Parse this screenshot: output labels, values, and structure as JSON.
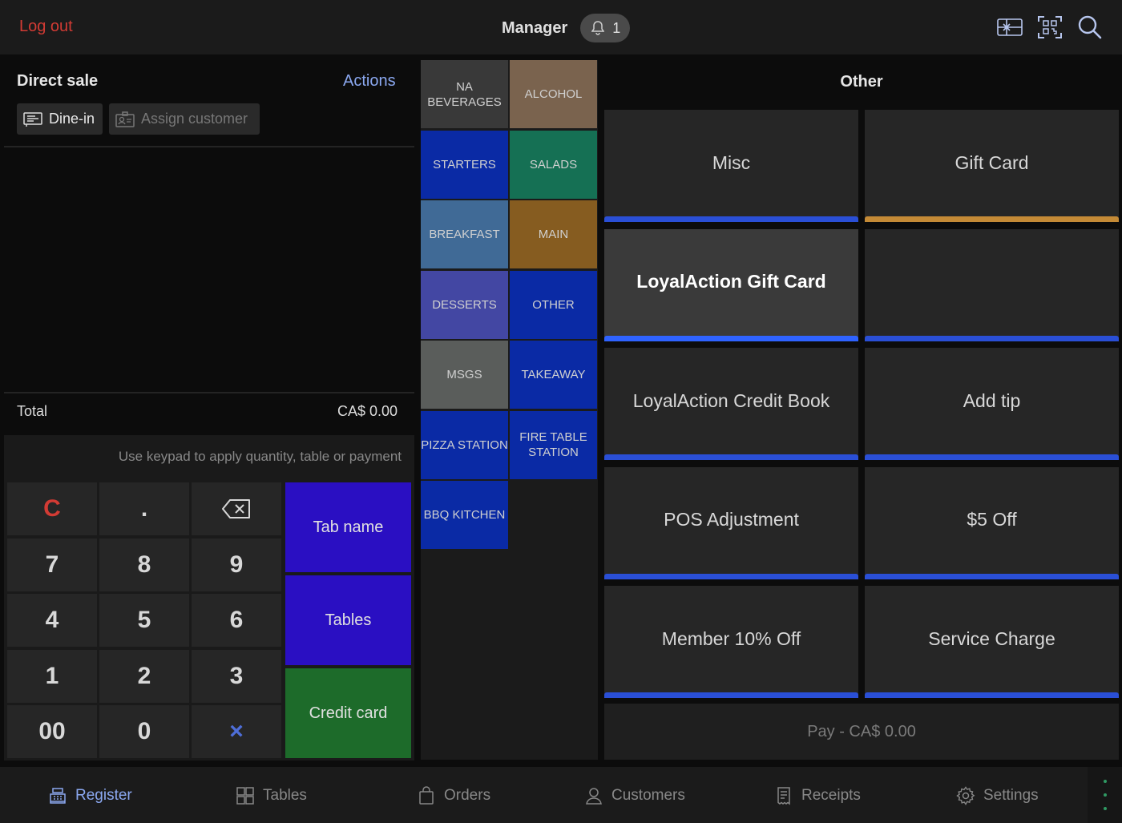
{
  "topbar": {
    "logout_label": "Log out",
    "user": "Manager",
    "notification_count": "1",
    "icons": [
      "gift-card-icon",
      "qr-scan-icon",
      "search-icon"
    ]
  },
  "sale": {
    "title": "Direct sale",
    "actions_label": "Actions",
    "dine_label": "Dine-in",
    "assign_label": "Assign customer",
    "total_label": "Total",
    "total_value": "CA$ 0.00"
  },
  "keypad": {
    "hint": "Use keypad to apply quantity, table or payment",
    "keys": [
      "C",
      ".",
      "⌫",
      "7",
      "8",
      "9",
      "4",
      "5",
      "6",
      "1",
      "2",
      "3",
      "00",
      "0",
      "×"
    ],
    "actions": [
      {
        "label": "Tab name",
        "color": "#2a0fc2"
      },
      {
        "label": "Tables",
        "color": "#2a0fc2"
      },
      {
        "label": "Credit card",
        "color": "#1d6b2a"
      }
    ]
  },
  "categories": [
    {
      "label": "NA BEVERAGES",
      "color": "#393939"
    },
    {
      "label": "ALCOHOL",
      "color": "#7a634e"
    },
    {
      "label": "STARTERS",
      "color": "#0a2aa5"
    },
    {
      "label": "SALADS",
      "color": "#157054"
    },
    {
      "label": "BREAKFAST",
      "color": "#406a96"
    },
    {
      "label": "MAIN",
      "color": "#865c20"
    },
    {
      "label": "DESSERTS",
      "color": "#4347a3"
    },
    {
      "label": "OTHER",
      "color": "#0a2aa5"
    },
    {
      "label": "MSGS",
      "color": "#5a5d5b"
    },
    {
      "label": "TAKEAWAY",
      "color": "#0a2aa5"
    },
    {
      "label": "PIZZA STATION",
      "color": "#0a2aa5"
    },
    {
      "label": "FIRE TABLE STATION",
      "color": "#0a2aa5"
    },
    {
      "label": "BBQ KITCHEN",
      "color": "#0a2aa5"
    }
  ],
  "products": {
    "title": "Other",
    "tiles": [
      {
        "label": "Misc",
        "accent": "#2a4fd6"
      },
      {
        "label": "Gift Card",
        "accent": "#c48a36"
      },
      {
        "label": "LoyalAction Gift Card",
        "accent": "#2f63ff",
        "selected": true
      },
      {
        "label": "",
        "accent": "#2a4fd6"
      },
      {
        "label": "LoyalAction Credit Book",
        "accent": "#2a4fd6"
      },
      {
        "label": "Add tip",
        "accent": "#2a4fd6"
      },
      {
        "label": "POS Adjustment",
        "accent": "#2a4fd6"
      },
      {
        "label": "$5 Off",
        "accent": "#2a4fd6"
      },
      {
        "label": "Member 10% Off",
        "accent": "#2a4fd6"
      },
      {
        "label": "Service Charge",
        "accent": "#2a4fd6"
      }
    ],
    "pay_label": "Pay - CA$ 0.00"
  },
  "nav": {
    "items": [
      {
        "label": "Register",
        "icon": "register-icon",
        "active": true
      },
      {
        "label": "Tables",
        "icon": "tables-icon"
      },
      {
        "label": "Orders",
        "icon": "shopping-bag-icon"
      },
      {
        "label": "Customers",
        "icon": "customer-icon"
      },
      {
        "label": "Receipts",
        "icon": "receipt-icon"
      },
      {
        "label": "Settings",
        "icon": "gear-icon"
      }
    ],
    "dots_color": "#2f9a63"
  }
}
